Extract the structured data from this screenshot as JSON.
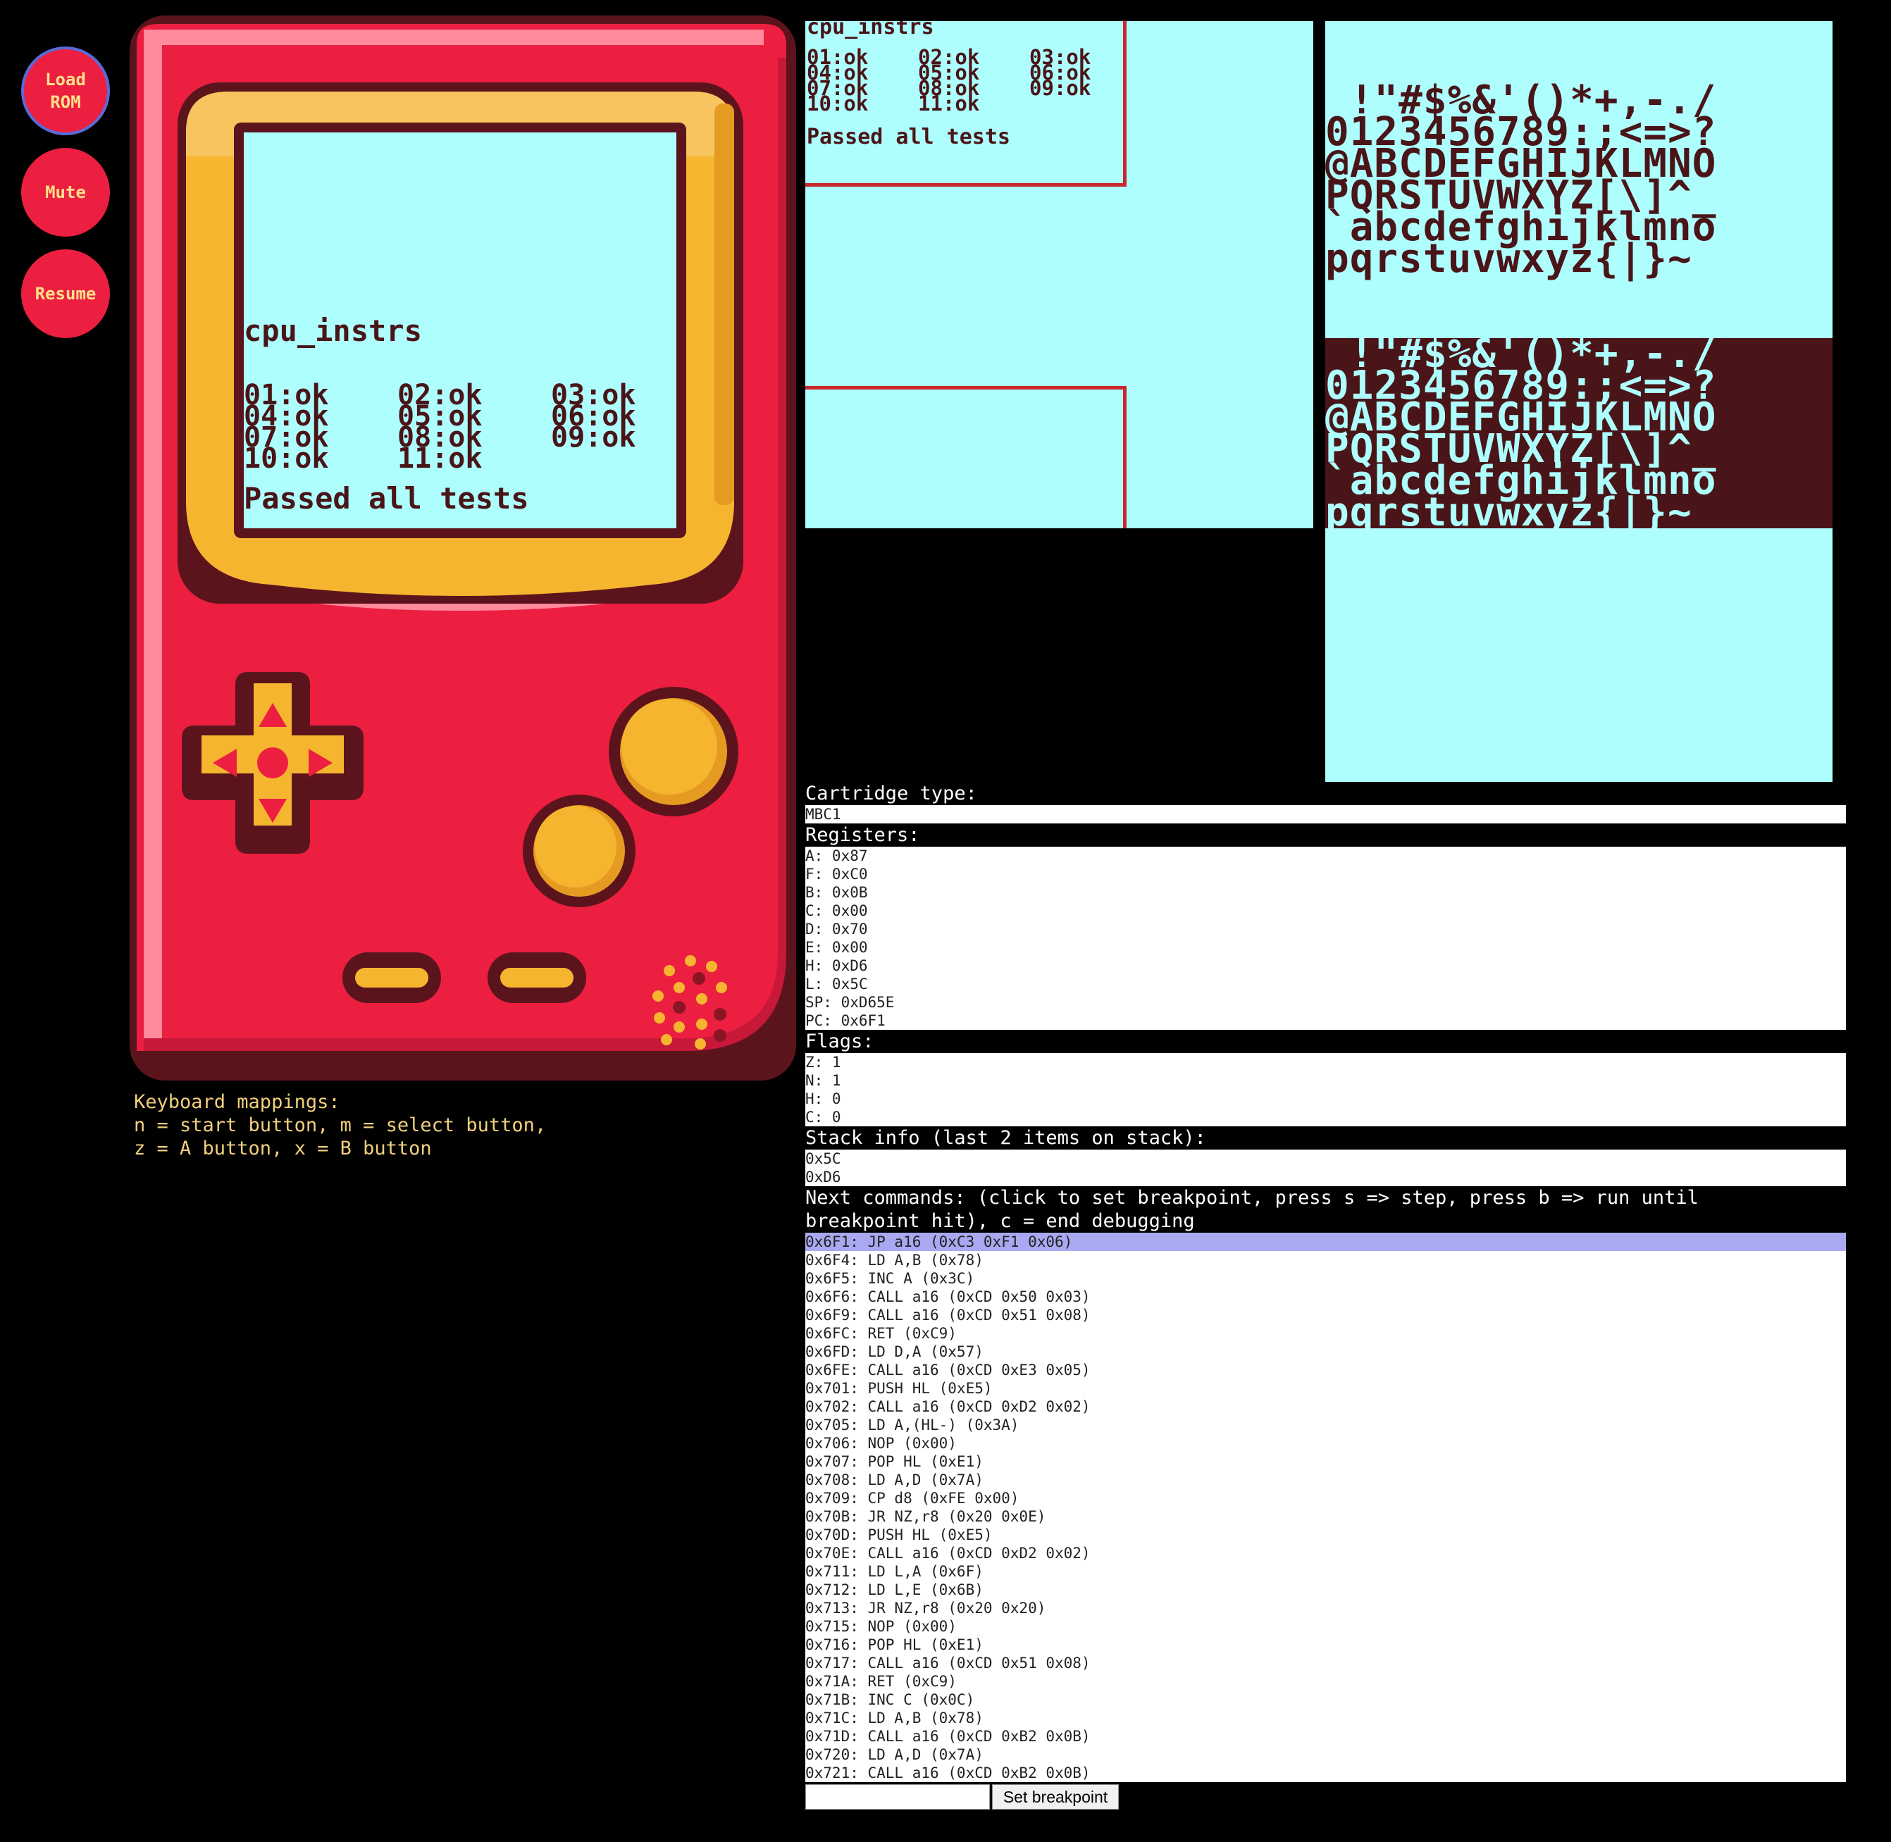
{
  "controls": {
    "load_rom": "Load\nROM",
    "mute": "Mute",
    "resume": "Resume"
  },
  "screen": {
    "title": "cpu_instrs",
    "results_rows": [
      [
        "01:ok",
        "02:ok",
        "03:ok"
      ],
      [
        "04:ok",
        "05:ok",
        "06:ok"
      ],
      [
        "07:ok",
        "08:ok",
        "09:ok"
      ],
      [
        "10:ok",
        "11:ok",
        ""
      ]
    ],
    "summary": "Passed all tests",
    "background_color": "#aefefe",
    "ink_color": "#4a1518"
  },
  "keyboard": {
    "lines": [
      "Keyboard mappings:",
      "n = start button, m = select button,",
      "z = A button, x = B button"
    ]
  },
  "tileset": {
    "rows": [
      " !\"#$%&'()*+,-./",
      "0123456789:;<=>?",
      "@ABCDEFGHIJKLMNO",
      "PQRSTUVWXYZ[\\]^_",
      "`abcdefghijklmno",
      "pqrstuvwxyz{|}~"
    ]
  },
  "debugger": {
    "cartridge_label": "Cartridge type:",
    "cartridge_value": "MBC1",
    "registers_label": "Registers:",
    "registers": [
      "A: 0x87",
      "F: 0xC0",
      "B: 0x0B",
      "C: 0x00",
      "D: 0x70",
      "E: 0x00",
      "H: 0xD6",
      "L: 0x5C",
      "SP: 0xD65E",
      "PC: 0x6F1"
    ],
    "flags_label": "Flags:",
    "flags": [
      "Z: 1",
      "N: 1",
      "H: 0",
      "C: 0"
    ],
    "stack_label": "Stack info (last 2 items on stack):",
    "stack": [
      "0x5C",
      "0xD6"
    ],
    "commands_label": "Next commands: (click to set breakpoint, press s => step, press b => run until\nbreakpoint hit), c = end debugging",
    "commands": [
      "0x6F1: JP a16 (0xC3 0xF1 0x06)",
      "0x6F4: LD A,B (0x78)",
      "0x6F5: INC A (0x3C)",
      "0x6F6: CALL a16 (0xCD 0x50 0x03)",
      "0x6F9: CALL a16 (0xCD 0x51 0x08)",
      "0x6FC: RET (0xC9)",
      "0x6FD: LD D,A (0x57)",
      "0x6FE: CALL a16 (0xCD 0xE3 0x05)",
      "0x701: PUSH HL (0xE5)",
      "0x702: CALL a16 (0xCD 0xD2 0x02)",
      "0x705: LD A,(HL-) (0x3A)",
      "0x706: NOP (0x00)",
      "0x707: POP HL (0xE1)",
      "0x708: LD A,D (0x7A)",
      "0x709: CP d8 (0xFE 0x00)",
      "0x70B: JR NZ,r8 (0x20 0x0E)",
      "0x70D: PUSH HL (0xE5)",
      "0x70E: CALL a16 (0xCD 0xD2 0x02)",
      "0x711: LD L,A (0x6F)",
      "0x712: LD L,E (0x6B)",
      "0x713: JR NZ,r8 (0x20 0x20)",
      "0x715: NOP (0x00)",
      "0x716: POP HL (0xE1)",
      "0x717: CALL a16 (0xCD 0x51 0x08)",
      "0x71A: RET (0xC9)",
      "0x71B: INC C (0x0C)",
      "0x71C: LD A,B (0x78)",
      "0x71D: CALL a16 (0xCD 0xB2 0x0B)",
      "0x720: LD A,D (0x7A)",
      "0x721: CALL a16 (0xCD 0xB2 0x0B)"
    ],
    "selected_command": 0,
    "breakpoint_input_value": "",
    "set_breakpoint_label": "Set breakpoint",
    "highlight_color": "#a9a9f2"
  }
}
